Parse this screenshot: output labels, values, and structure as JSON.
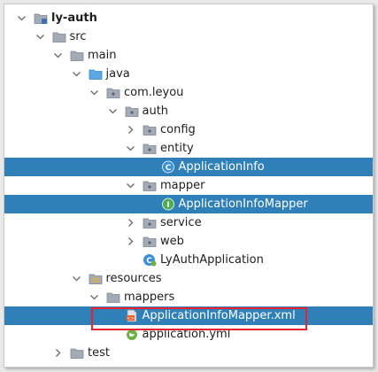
{
  "tree": {
    "rows": [
      {
        "label": "ly-auth",
        "depth": 0,
        "chevron": "down",
        "icon": "module-folder-icon",
        "bold": true
      },
      {
        "label": "src",
        "depth": 1,
        "chevron": "down",
        "icon": "folder-icon"
      },
      {
        "label": "main",
        "depth": 2,
        "chevron": "down",
        "icon": "folder-icon"
      },
      {
        "label": "java",
        "depth": 3,
        "chevron": "down",
        "icon": "source-folder-icon"
      },
      {
        "label": "com.leyou",
        "depth": 4,
        "chevron": "down",
        "icon": "package-icon"
      },
      {
        "label": "auth",
        "depth": 5,
        "chevron": "down",
        "icon": "package-icon"
      },
      {
        "label": "config",
        "depth": 6,
        "chevron": "right",
        "icon": "package-icon"
      },
      {
        "label": "entity",
        "depth": 6,
        "chevron": "down",
        "icon": "package-icon"
      },
      {
        "label": "ApplicationInfo",
        "depth": 7,
        "chevron": "none",
        "icon": "class-icon",
        "selected": true
      },
      {
        "label": "mapper",
        "depth": 6,
        "chevron": "down",
        "icon": "package-icon"
      },
      {
        "label": "ApplicationInfoMapper",
        "depth": 7,
        "chevron": "none",
        "icon": "interface-icon",
        "selected": true
      },
      {
        "label": "service",
        "depth": 6,
        "chevron": "right",
        "icon": "package-icon"
      },
      {
        "label": "web",
        "depth": 6,
        "chevron": "right",
        "icon": "package-icon"
      },
      {
        "label": "LyAuthApplication",
        "depth": 6,
        "chevron": "none",
        "icon": "spring-boot-class-icon"
      },
      {
        "label": "resources",
        "depth": 3,
        "chevron": "down",
        "icon": "resources-folder-icon"
      },
      {
        "label": "mappers",
        "depth": 4,
        "chevron": "down",
        "icon": "folder-icon"
      },
      {
        "label": "ApplicationInfoMapper.xml",
        "depth": 5,
        "chevron": "none",
        "icon": "xml-file-icon",
        "selected": true,
        "highlighted": true
      },
      {
        "label": "application.yml",
        "depth": 5,
        "chevron": "none",
        "icon": "yaml-file-icon"
      },
      {
        "label": "test",
        "depth": 2,
        "chevron": "right",
        "icon": "folder-icon"
      }
    ]
  },
  "colors": {
    "selection": "#2f7fb8",
    "highlight_border": "#e8222f",
    "folder": "#a0a8b4",
    "source_folder": "#5aa9e6",
    "class_icon": "#3a8fd8",
    "interface_icon": "#4caf50"
  }
}
